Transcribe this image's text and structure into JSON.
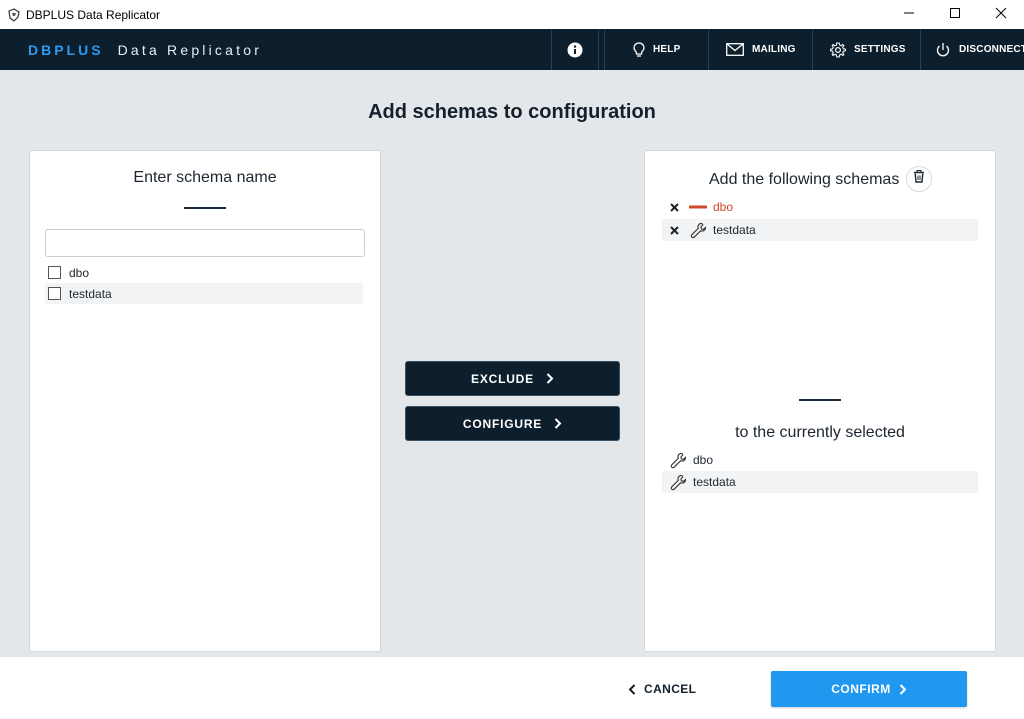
{
  "window": {
    "title": "DBPLUS Data Replicator",
    "app_icon": "dbplus-logo-icon",
    "controls": [
      "minimize-icon",
      "maximize-icon",
      "close-icon"
    ]
  },
  "header": {
    "brand_primary": "DBPLUS",
    "brand_secondary": "Data Replicator",
    "nav": {
      "info_icon": "info-icon",
      "help": "HELP",
      "mailing": "MAILING",
      "settings": "SETTINGS",
      "disconnect": "DISCONNECT"
    }
  },
  "page": {
    "title": "Add schemas to configuration"
  },
  "left_panel": {
    "heading": "Enter schema name",
    "search": {
      "value": "",
      "placeholder": ""
    },
    "schemas": [
      {
        "label": "dbo",
        "checked": false
      },
      {
        "label": "testdata",
        "checked": false
      }
    ]
  },
  "middle": {
    "exclude_label": "EXCLUDE",
    "configure_label": "CONFIGURE"
  },
  "right_panel": {
    "heading": "Add the following schemas",
    "trash_icon": "trash-icon",
    "selected": [
      {
        "label": "dbo",
        "icon": "exclude-dash-icon",
        "color": "#d0492a"
      },
      {
        "label": "testdata",
        "icon": "wrench-icon"
      }
    ],
    "current_heading": "to the currently selected",
    "current": [
      {
        "label": "dbo",
        "icon": "wrench-icon"
      },
      {
        "label": "testdata",
        "icon": "wrench-icon"
      }
    ]
  },
  "footer": {
    "cancel_label": "CANCEL",
    "confirm_label": "CONFIRM"
  },
  "colors": {
    "header_bg": "#0d1f2d",
    "brand_accent": "#2d9bf0",
    "confirm_bg": "#2198f0",
    "exclude_red": "#d0492a",
    "page_bg": "#e4e7ea"
  }
}
